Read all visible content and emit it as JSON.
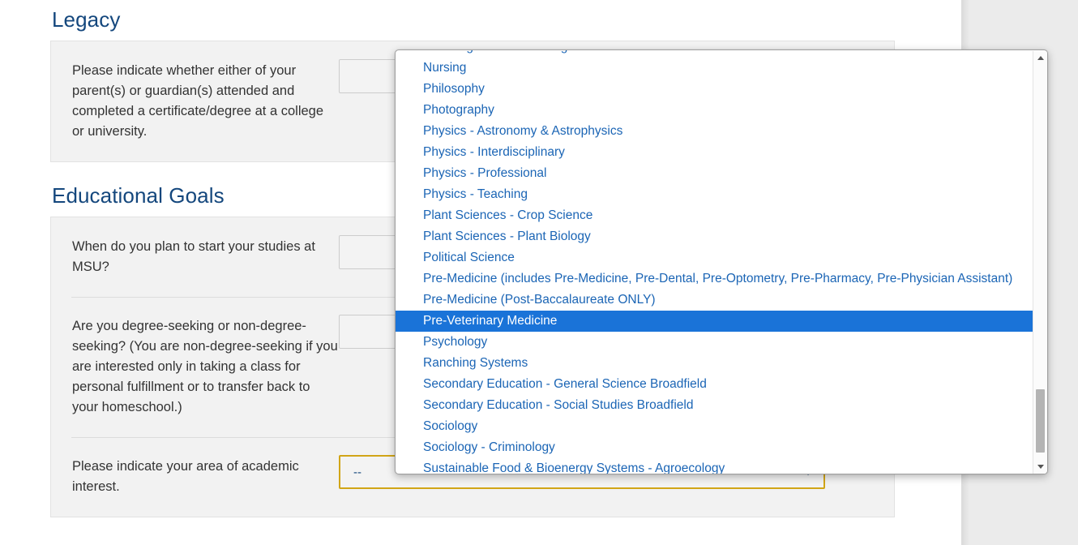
{
  "sections": [
    {
      "title": "Legacy",
      "questions": [
        {
          "label": "Please indicate whether either of your parent(s) or guardian(s) attended and completed a certificate/degree at a college or university.",
          "control": "select",
          "value": ""
        }
      ]
    },
    {
      "title": "Educational Goals",
      "questions": [
        {
          "label": "When do you plan to start your studies at MSU?",
          "control": "select",
          "value": ""
        },
        {
          "label": "Are you degree-seeking or non-degree-seeking? (You are non-degree-seeking if you are interested only in taking a class for personal fulfillment or to transfer back to your homeschool.)",
          "control": "select",
          "value": ""
        },
        {
          "label": "Please indicate your area of academic interest.",
          "control": "select-open",
          "value": "--"
        }
      ]
    }
  ],
  "dropdown": {
    "selected_index": 13,
    "scroll_position": "near-bottom",
    "up_arrow_icon": "arrow-up-icon",
    "down_arrow_icon": "arrow-down-icon",
    "options": [
      "Non-Degree MSU Undergraduate",
      "Nursing",
      "Philosophy",
      "Photography",
      "Physics - Astronomy & Astrophysics",
      "Physics - Interdisciplinary",
      "Physics - Professional",
      "Physics - Teaching",
      "Plant Sciences - Crop Science",
      "Plant Sciences - Plant Biology",
      "Political Science",
      "Pre-Medicine (includes Pre-Medicine, Pre-Dental, Pre-Optometry, Pre-Pharmacy, Pre-Physician Assistant)",
      "Pre-Medicine (Post-Baccalaureate ONLY)",
      "Pre-Veterinary Medicine",
      "Psychology",
      "Ranching Systems",
      "Secondary Education - General Science Broadfield",
      "Secondary Education - Social Studies Broadfield",
      "Sociology",
      "Sociology - Criminology",
      "Sustainable Food & Bioenergy Systems - Agroecology"
    ]
  },
  "colors": {
    "heading": "#14477d",
    "link": "#1b65b5",
    "highlight": "#1a73d8",
    "focus_border": "#d1a517",
    "panel_bg": "#f2f2f2"
  }
}
